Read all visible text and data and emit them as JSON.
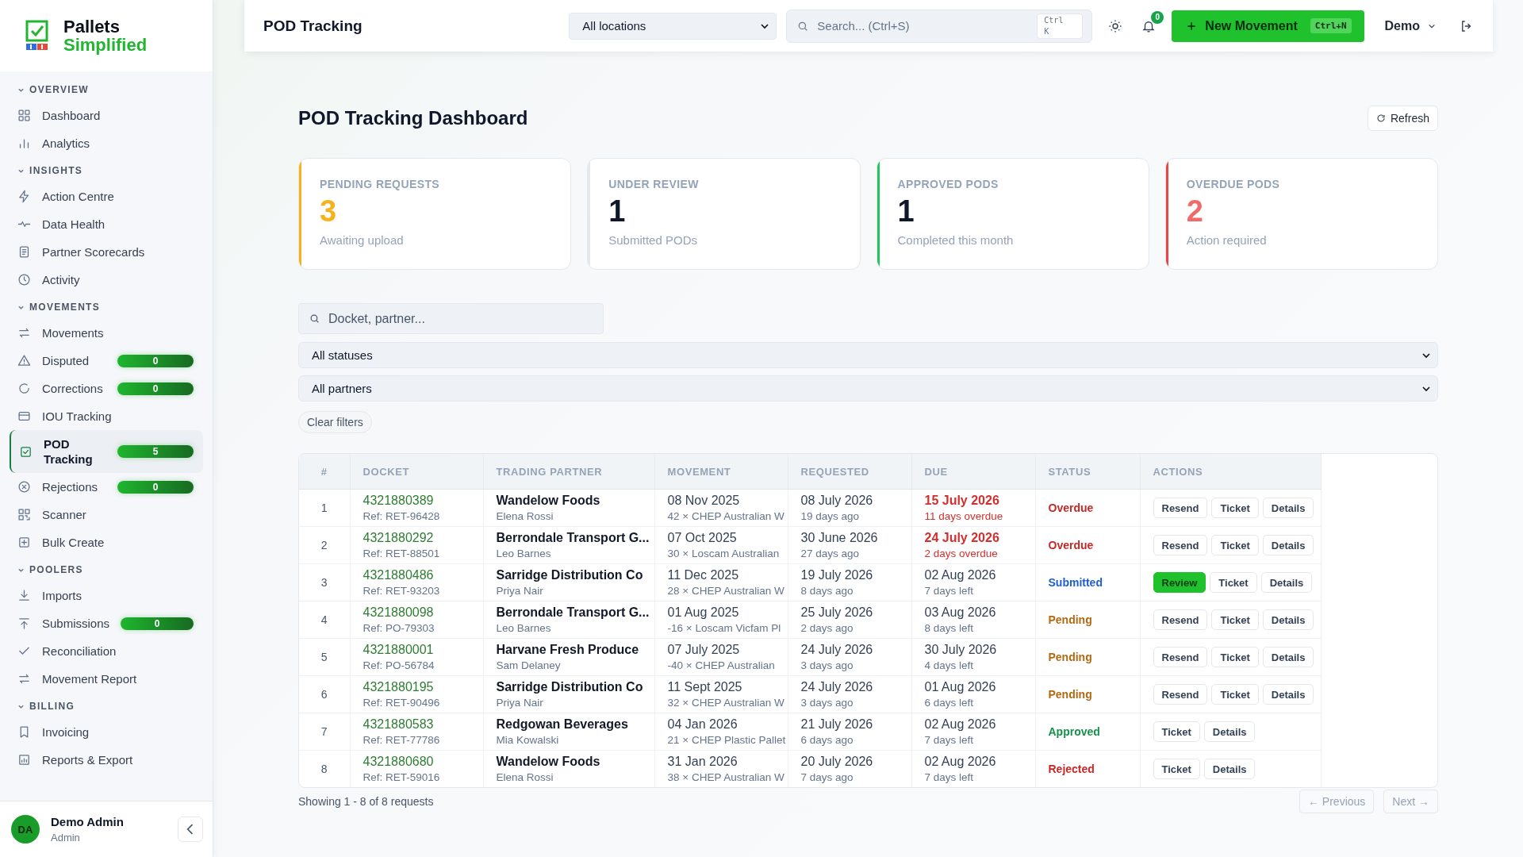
{
  "brand": {
    "line1": "Pallets",
    "line2": "Simplified"
  },
  "sidebar": {
    "sections": [
      {
        "title": "OVERVIEW",
        "expanded": true,
        "items": [
          {
            "label": "Dashboard",
            "selected": false
          },
          {
            "label": "Analytics",
            "selected": false
          }
        ]
      },
      {
        "title": "INSIGHTS",
        "expanded": true,
        "items": [
          {
            "label": "Action Centre",
            "selected": false
          },
          {
            "label": "Data Health",
            "selected": false
          },
          {
            "label": "Partner Scorecards",
            "selected": false
          },
          {
            "label": "Activity",
            "selected": false
          }
        ]
      },
      {
        "title": "MOVEMENTS",
        "expanded": true,
        "items": [
          {
            "label": "Movements",
            "selected": false
          },
          {
            "label": "Disputed",
            "selected": false,
            "badge": "0"
          },
          {
            "label": "Corrections",
            "selected": false,
            "badge": "0"
          },
          {
            "label": "IOU Tracking",
            "selected": false
          },
          {
            "label": "POD Tracking",
            "selected": true,
            "badge": "5"
          },
          {
            "label": "Rejections",
            "selected": false,
            "badge": "0"
          },
          {
            "label": "Scanner",
            "selected": false
          },
          {
            "label": "Bulk Create",
            "selected": false
          }
        ]
      },
      {
        "title": "POOLERS",
        "expanded": true,
        "items": [
          {
            "label": "Imports",
            "selected": false
          },
          {
            "label": "Submissions",
            "selected": false,
            "badge": "0"
          },
          {
            "label": "Reconciliation",
            "selected": false
          },
          {
            "label": "Movement Report",
            "selected": false
          }
        ]
      },
      {
        "title": "BILLING",
        "expanded": true,
        "items": [
          {
            "label": "Invoicing",
            "selected": false
          },
          {
            "label": "Reports & Export",
            "selected": false
          }
        ]
      }
    ],
    "user": {
      "initials": "DA",
      "name": "Demo Admin",
      "role": "Admin"
    }
  },
  "topbar": {
    "title": "POD Tracking",
    "location": "All locations",
    "search_placeholder": "Search... (Ctrl+S)",
    "search_shortcut": [
      "Ctrl",
      "K"
    ],
    "notifications": "0",
    "new_button": "New Movement",
    "new_shortcut": "Ctrl+N",
    "user": "Demo"
  },
  "page": {
    "title": "POD Tracking Dashboard",
    "refresh": "Refresh"
  },
  "cards": [
    {
      "label": "PENDING REQUESTS",
      "value": "3",
      "note": "Awaiting upload",
      "color": "#f5b21b"
    },
    {
      "label": "UNDER REVIEW",
      "value": "1",
      "note": "Submitted PODs",
      "color": "#e5e7eb"
    },
    {
      "label": "APPROVED PODS",
      "value": "1",
      "note": "Completed this month",
      "color": "#22c55e"
    },
    {
      "label": "OVERDUE PODS",
      "value": "2",
      "note": "Action required",
      "color": "#ef4444"
    }
  ],
  "filters": {
    "search_placeholder": "Docket, partner...",
    "status": "All statuses",
    "partner": "All partners",
    "clear": "Clear filters"
  },
  "table": {
    "columns": [
      "#",
      "DOCKET",
      "TRADING PARTNER",
      "MOVEMENT",
      "REQUESTED",
      "DUE",
      "STATUS",
      "ACTIONS"
    ],
    "rows": [
      {
        "n": "1",
        "docket": "4321880389",
        "ref": "Ref: RET-96428",
        "partner": "Wandelow Foods",
        "contact": "Elena Rossi",
        "date": "08 Nov 2025",
        "movement": "42 × CHEP Australian W",
        "requested": "08 July 2026",
        "ago": "19 days ago",
        "due": "15 July 2026",
        "due_note": "11 days overdue",
        "overdue": true,
        "status": "Overdue",
        "kind": "overdue",
        "actions": [
          {
            "label": "Resend",
            "kind": "default"
          },
          {
            "label": "Ticket",
            "kind": "default"
          },
          {
            "label": "Details",
            "kind": "default"
          }
        ]
      },
      {
        "n": "2",
        "docket": "4321880292",
        "ref": "Ref: RET-88501",
        "partner": "Berrondale Transport G...",
        "contact": "Leo Barnes",
        "date": "07 Oct 2025",
        "movement": "30 × Loscam Australian",
        "requested": "30 June 2026",
        "ago": "27 days ago",
        "due": "24 July 2026",
        "due_note": "2 days overdue",
        "overdue": true,
        "status": "Overdue",
        "kind": "overdue",
        "actions": [
          {
            "label": "Resend",
            "kind": "default"
          },
          {
            "label": "Ticket",
            "kind": "default"
          },
          {
            "label": "Details",
            "kind": "default"
          }
        ]
      },
      {
        "n": "3",
        "docket": "4321880486",
        "ref": "Ref: RET-93203",
        "partner": "Sarridge Distribution Co",
        "contact": "Priya Nair",
        "date": "11 Dec 2025",
        "movement": "28 × CHEP Australian W",
        "requested": "19 July 2026",
        "ago": "8 days ago",
        "due": "02 Aug 2026",
        "due_note": "7 days left",
        "overdue": false,
        "status": "Submitted",
        "kind": "submitted",
        "actions": [
          {
            "label": "Review",
            "kind": "primary"
          },
          {
            "label": "Ticket",
            "kind": "default"
          },
          {
            "label": "Details",
            "kind": "default"
          }
        ]
      },
      {
        "n": "4",
        "docket": "4321880098",
        "ref": "Ref: PO-79303",
        "partner": "Berrondale Transport G...",
        "contact": "Leo Barnes",
        "date": "01 Aug 2025",
        "movement": "-16 × Loscam Vicfam Pl",
        "requested": "25 July 2026",
        "ago": "2 days ago",
        "due": "03 Aug 2026",
        "due_note": "8 days left",
        "overdue": false,
        "status": "Pending",
        "kind": "pending",
        "actions": [
          {
            "label": "Resend",
            "kind": "default"
          },
          {
            "label": "Ticket",
            "kind": "default"
          },
          {
            "label": "Details",
            "kind": "default"
          }
        ]
      },
      {
        "n": "5",
        "docket": "4321880001",
        "ref": "Ref: PO-56784",
        "partner": "Harvane Fresh Produce",
        "contact": "Sam Delaney",
        "date": "07 July 2025",
        "movement": "-40 × CHEP Australian",
        "requested": "24 July 2026",
        "ago": "3 days ago",
        "due": "30 July 2026",
        "due_note": "4 days left",
        "overdue": false,
        "status": "Pending",
        "kind": "pending",
        "actions": [
          {
            "label": "Resend",
            "kind": "default"
          },
          {
            "label": "Ticket",
            "kind": "default"
          },
          {
            "label": "Details",
            "kind": "default"
          }
        ]
      },
      {
        "n": "6",
        "docket": "4321880195",
        "ref": "Ref: RET-90496",
        "partner": "Sarridge Distribution Co",
        "contact": "Priya Nair",
        "date": "11 Sept 2025",
        "movement": "32 × CHEP Australian W",
        "requested": "24 July 2026",
        "ago": "3 days ago",
        "due": "01 Aug 2026",
        "due_note": "6 days left",
        "overdue": false,
        "status": "Pending",
        "kind": "pending",
        "actions": [
          {
            "label": "Resend",
            "kind": "default"
          },
          {
            "label": "Ticket",
            "kind": "default"
          },
          {
            "label": "Details",
            "kind": "default"
          }
        ]
      },
      {
        "n": "7",
        "docket": "4321880583",
        "ref": "Ref: RET-77786",
        "partner": "Redgowan Beverages",
        "contact": "Mia Kowalski",
        "date": "04 Jan 2026",
        "movement": "21 × CHEP Plastic Pallet",
        "requested": "21 July 2026",
        "ago": "6 days ago",
        "due": "02 Aug 2026",
        "due_note": "7 days left",
        "overdue": false,
        "status": "Approved",
        "kind": "approved",
        "actions": [
          {
            "label": "Ticket",
            "kind": "default"
          },
          {
            "label": "Details",
            "kind": "default"
          }
        ]
      },
      {
        "n": "8",
        "docket": "4321880680",
        "ref": "Ref: RET-59016",
        "partner": "Wandelow Foods",
        "contact": "Elena Rossi",
        "date": "31 Jan 2026",
        "movement": "38 × CHEP Australian W",
        "requested": "20 July 2026",
        "ago": "7 days ago",
        "due": "02 Aug 2026",
        "due_note": "7 days left",
        "overdue": false,
        "status": "Rejected",
        "kind": "rejected",
        "actions": [
          {
            "label": "Ticket",
            "kind": "default"
          },
          {
            "label": "Details",
            "kind": "default"
          }
        ]
      }
    ]
  },
  "footer": {
    "summary": "Showing 1 - 8 of 8 requests",
    "prev": "← Previous",
    "next": "Next →"
  }
}
